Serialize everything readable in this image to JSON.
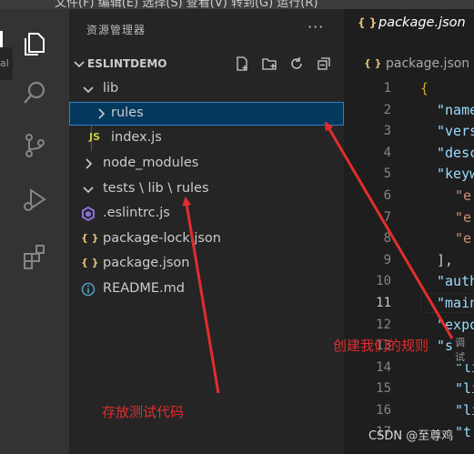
{
  "topbar": {
    "menu": "文件(F)  编辑(E)  选择(S)  查看(V)  转到(G)  运行(R)"
  },
  "left_edge": {
    "label": "al"
  },
  "sidebar": {
    "title": "资源管理器",
    "more": "···",
    "workspace": "ESLINTDEMO",
    "tree": [
      {
        "label": "lib"
      },
      {
        "label": "rules"
      },
      {
        "icon": "JS",
        "label": "index.js"
      },
      {
        "label": "node_modules"
      },
      {
        "label": "tests \\ lib \\ rules"
      },
      {
        "label": ".eslintrc.js"
      },
      {
        "icon": "{ }",
        "label": "package-lock.json"
      },
      {
        "icon": "{ }",
        "label": "package.json"
      },
      {
        "label": "README.md"
      }
    ]
  },
  "editor": {
    "tab": {
      "icon": "{ }",
      "label": "package.json"
    },
    "breadcrumb": {
      "icon": "{ }",
      "label": "package.json"
    },
    "lines": [
      {
        "n": "1",
        "text": "{"
      },
      {
        "n": "2",
        "text": "\"name"
      },
      {
        "n": "3",
        "text": "\"vers"
      },
      {
        "n": "4",
        "text": "\"desc"
      },
      {
        "n": "5",
        "text": "\"keyw"
      },
      {
        "n": "6",
        "text": "\"e"
      },
      {
        "n": "7",
        "text": "\"e"
      },
      {
        "n": "8",
        "text": "\"e"
      },
      {
        "n": "9",
        "text": "],"
      },
      {
        "n": "10",
        "text": "\"auth"
      },
      {
        "n": "11",
        "text": "\"main"
      },
      {
        "n": "12",
        "text": "\"expo"
      },
      {
        "n": "13",
        "text": "\"scri"
      },
      {
        "n": "14",
        "text": "\"li"
      },
      {
        "n": "15",
        "text": "\"li"
      },
      {
        "n": "16",
        "text": "\"li"
      },
      {
        "n": "17",
        "text": "\"t"
      }
    ],
    "inline_hint": "调试"
  },
  "annotations": {
    "rules_note": "创建我们的规则",
    "tests_note": "存放测试代码"
  },
  "watermark": "CSDN @至尊鸡",
  "colors": {
    "annotation": "#e32d2d",
    "selection": "#04395e",
    "json_icon": "#e5c07b",
    "js_icon": "#cbcb41"
  }
}
